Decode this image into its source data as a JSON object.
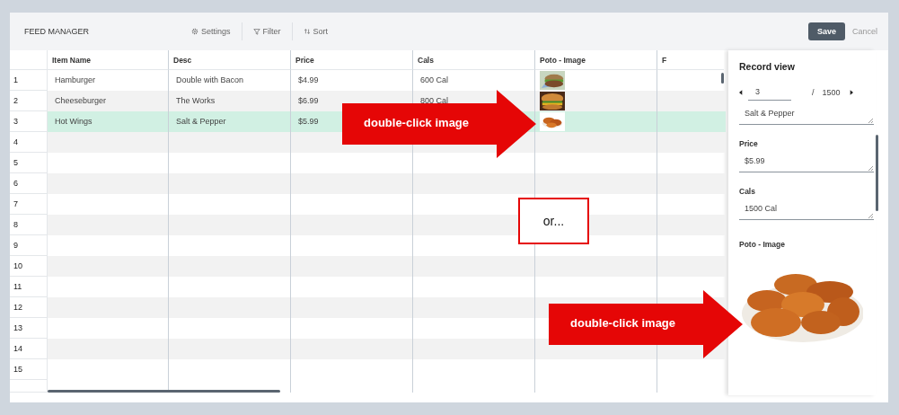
{
  "header": {
    "title": "FEED MANAGER",
    "toolbar": [
      {
        "kind": "settings",
        "label": "Settings"
      },
      {
        "kind": "filter",
        "label": "Filter"
      },
      {
        "kind": "sort",
        "label": "Sort"
      }
    ],
    "save": "Save",
    "cancel": "Cancel"
  },
  "table": {
    "columns": [
      "Item Name",
      "Desc",
      "Price",
      "Cals",
      "Poto - Image",
      "F"
    ],
    "rows": [
      {
        "number": "1",
        "cells": [
          "Hamburger",
          "Double with Bacon",
          "$4.99",
          "600 Cal"
        ],
        "photo": {
          "kind": "picture"
        },
        "selected": false
      },
      {
        "number": "2",
        "cells": [
          "Cheeseburger",
          "The Works",
          "$6.99",
          "800 Cal"
        ],
        "photo": {
          "kind": "picture"
        },
        "selected": false
      },
      {
        "number": "3",
        "cells": [
          "Hot Wings",
          "Salt & Pepper",
          "$5.99"
        ],
        "photo": {
          "kind": "picture"
        },
        "selected": true
      },
      {
        "number": "4",
        "selected": false
      },
      {
        "number": "5",
        "selected": false
      },
      {
        "number": "6",
        "selected": false
      },
      {
        "number": "7",
        "selected": false
      },
      {
        "number": "8",
        "selected": false
      },
      {
        "number": "9",
        "selected": false
      },
      {
        "number": "10",
        "selected": false
      },
      {
        "number": "11",
        "selected": false
      },
      {
        "number": "12",
        "selected": false
      },
      {
        "number": "13",
        "selected": false
      },
      {
        "number": "14",
        "selected": false
      },
      {
        "number": "15",
        "selected": false
      }
    ]
  },
  "record_view": {
    "title": "Record view",
    "current": "3",
    "separator": "/",
    "total": "1500",
    "fields": [
      {
        "value": "Salt & Pepper"
      },
      {
        "label": "Price",
        "value": "$5.99"
      },
      {
        "label": "Cals",
        "value": "1500 Cal"
      }
    ],
    "image_label": "Poto - Image",
    "image": {
      "kind": "picture"
    }
  },
  "annotations": {
    "callouts": [
      "double-click image",
      "double-click image"
    ],
    "or_box": "or..."
  }
}
